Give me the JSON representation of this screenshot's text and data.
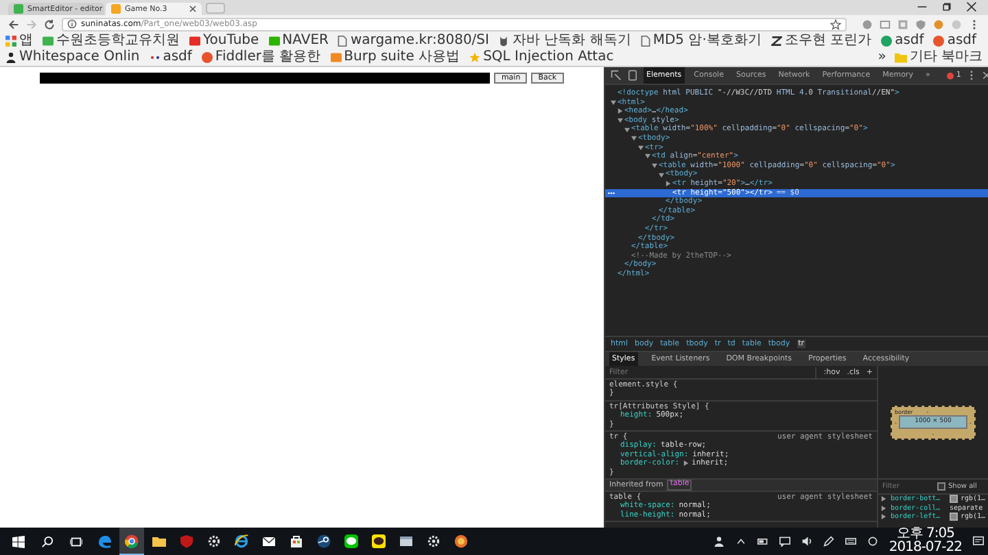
{
  "browser_tabs": [
    {
      "title": "SmartEditor - editor",
      "color": "#3fb34f",
      "selected": false
    },
    {
      "title": "Game No.3",
      "color": "#f5a623",
      "selected": true
    }
  ],
  "address": {
    "host": "suninatas.com",
    "path": "/Part_one/web03/web03.asp"
  },
  "bookmarks": [
    {
      "kind": "apps",
      "label": "앱"
    },
    {
      "kind": "square",
      "color": "#3fb34f",
      "label": "수원초등학교유치원"
    },
    {
      "kind": "square",
      "color": "#e52d27",
      "label": "YouTube"
    },
    {
      "kind": "square",
      "color": "#2db400",
      "label": "NAVER"
    },
    {
      "kind": "page",
      "label": "wargame.kr:8080/SI"
    },
    {
      "kind": "owl",
      "label": "자바 난독화 해독기"
    },
    {
      "kind": "page",
      "label": "MD5 암·복호화기"
    },
    {
      "kind": "zigzag",
      "label": "조우현 포린가"
    },
    {
      "kind": "dot",
      "color": "#1fa463",
      "label": "asdf"
    },
    {
      "kind": "dot",
      "color": "#e8542c",
      "label": "asdf"
    },
    {
      "kind": "person",
      "label": "Whitespace Onlin"
    },
    {
      "kind": "dots",
      "label": "asdf"
    },
    {
      "kind": "dot",
      "color": "#e8542c",
      "label": "Fiddler를 활용한"
    },
    {
      "kind": "square",
      "color": "#f08a24",
      "label": "Burp suite 사용법"
    },
    {
      "kind": "star",
      "label": "SQL Injection Attac"
    }
  ],
  "bookmarks_more": "»",
  "other_bookmarks": "기타 북마크",
  "page": {
    "buttons": [
      "main",
      "Back"
    ]
  },
  "devtools": {
    "tabs": [
      {
        "label": "Elements",
        "selected": true
      },
      {
        "label": "Console",
        "selected": false
      },
      {
        "label": "Sources",
        "selected": false
      },
      {
        "label": "Network",
        "selected": false
      },
      {
        "label": "Performance",
        "selected": false
      },
      {
        "label": "Memory",
        "selected": false
      }
    ],
    "more_tabs": "»",
    "error_count": "1",
    "dom": [
      {
        "text": "<!doctype html PUBLIC \"-//W3C//DTD HTML 4.0 Transitional//EN\">",
        "kind": "leaf",
        "selected": false
      },
      {
        "text": "<html>",
        "kind": "open",
        "selected": false,
        "close": "</html>",
        "children": [
          {
            "text": "<head>…</head>",
            "kind": "closed",
            "selected": false
          },
          {
            "text": "<body style>",
            "kind": "open",
            "selected": false,
            "close": "</body>",
            "children": [
              {
                "text": "<table width=\"100%\" cellpadding=\"0\" cellspacing=\"0\">",
                "kind": "open",
                "selected": false,
                "close": "</table>",
                "children": [
                  {
                    "text": "<tbody>",
                    "kind": "open",
                    "selected": false,
                    "close": "</tbody>",
                    "children": [
                      {
                        "text": "<tr>",
                        "kind": "open",
                        "selected": false,
                        "close": "</tr>",
                        "children": [
                          {
                            "text": "<td align=\"center\">",
                            "kind": "open",
                            "selected": false,
                            "close": "</td>",
                            "children": [
                              {
                                "text": "<table width=\"1000\" cellpadding=\"0\" cellspacing=\"0\">",
                                "kind": "open",
                                "selected": false,
                                "close": "</table>",
                                "children": [
                                  {
                                    "text": "<tbody>",
                                    "kind": "open",
                                    "selected": false,
                                    "close": "</tbody>",
                                    "children": [
                                      {
                                        "text": "<tr height=\"20\">…</tr>",
                                        "kind": "closed",
                                        "selected": false
                                      },
                                      {
                                        "text": "<tr height=\"500\"></tr>",
                                        "kind": "leaf",
                                        "selected": true,
                                        "marker": "== $0"
                                      }
                                    ]
                                  }
                                ]
                              }
                            ]
                          }
                        ]
                      }
                    ]
                  }
                ]
              },
              {
                "text": "<!--Made by 2theTOP-->",
                "kind": "comment",
                "selected": false
              }
            ]
          }
        ]
      }
    ],
    "breadcrumbs": [
      {
        "label": "html",
        "selected": false
      },
      {
        "label": "body",
        "selected": false
      },
      {
        "label": "table",
        "selected": false
      },
      {
        "label": "tbody",
        "selected": false
      },
      {
        "label": "tr",
        "selected": false
      },
      {
        "label": "td",
        "selected": false
      },
      {
        "label": "table",
        "selected": false
      },
      {
        "label": "tbody",
        "selected": false
      },
      {
        "label": "tr",
        "selected": true
      }
    ],
    "pane_tabs": [
      {
        "label": "Styles",
        "selected": true
      },
      {
        "label": "Event Listeners",
        "selected": false
      },
      {
        "label": "DOM Breakpoints",
        "selected": false
      },
      {
        "label": "Properties",
        "selected": false
      },
      {
        "label": "Accessibility",
        "selected": false
      }
    ],
    "styles_filter": {
      "placeholder": "Filter"
    },
    "hov": ":hov",
    "cls": ".cls",
    "add": "+",
    "rules": [
      {
        "kind": "rule",
        "open": "element.style {",
        "close": "}"
      },
      {
        "kind": "rule",
        "open": "tr[Attributes Style] {",
        "close": "}",
        "declarations": [
          {
            "property": "height:",
            "value": "500px;",
            "expandable": false
          }
        ]
      },
      {
        "kind": "rule",
        "open": "tr {",
        "source": "user agent stylesheet",
        "close": "}",
        "declarations": [
          {
            "property": "display:",
            "value": "table-row;",
            "expandable": false
          },
          {
            "property": "vertical-align:",
            "value": "inherit;",
            "expandable": false
          },
          {
            "property": "border-color:",
            "value": "inherit;",
            "expandable": true
          }
        ]
      },
      {
        "kind": "inherited",
        "label": "Inherited from",
        "tag": "table"
      },
      {
        "kind": "rule",
        "open": "table {",
        "source": "user agent stylesheet",
        "declarations": [
          {
            "property": "white-space:",
            "value": "normal;",
            "expandable": false
          },
          {
            "property": "line-height:",
            "value": "normal;",
            "expandable": false
          }
        ]
      }
    ],
    "box_model": {
      "label": "border",
      "top": "-",
      "right": "-",
      "bottom": "-",
      "left": "-",
      "content": "1000 × 500"
    },
    "computed": {
      "placeholder": "Filter",
      "show_all": {
        "label": "Show all",
        "checked": false
      },
      "properties": [
        {
          "name": "border-bott…",
          "value": "rgb(1…",
          "swatch": true
        },
        {
          "name": "border-coll…",
          "value": "separate",
          "swatch": false
        },
        {
          "name": "border-left…",
          "value": "rgb(1…",
          "swatch": true
        }
      ]
    }
  },
  "taskbar": {
    "apps": [
      {
        "kind": "edge",
        "active": false
      },
      {
        "kind": "chrome",
        "active": true
      },
      {
        "kind": "folder",
        "active": false
      },
      {
        "kind": "shield",
        "active": false
      },
      {
        "kind": "gear",
        "active": false
      },
      {
        "kind": "ie",
        "active": false
      },
      {
        "kind": "mail",
        "active": false
      },
      {
        "kind": "bag",
        "active": false
      },
      {
        "kind": "steam",
        "active": false
      },
      {
        "kind": "chat",
        "active": false
      },
      {
        "kind": "talk",
        "active": false
      },
      {
        "kind": "window",
        "active": false
      },
      {
        "kind": "gear",
        "active": false
      },
      {
        "kind": "fox",
        "active": false
      }
    ],
    "time": "오후 7:05",
    "date": "2018-07-22"
  }
}
